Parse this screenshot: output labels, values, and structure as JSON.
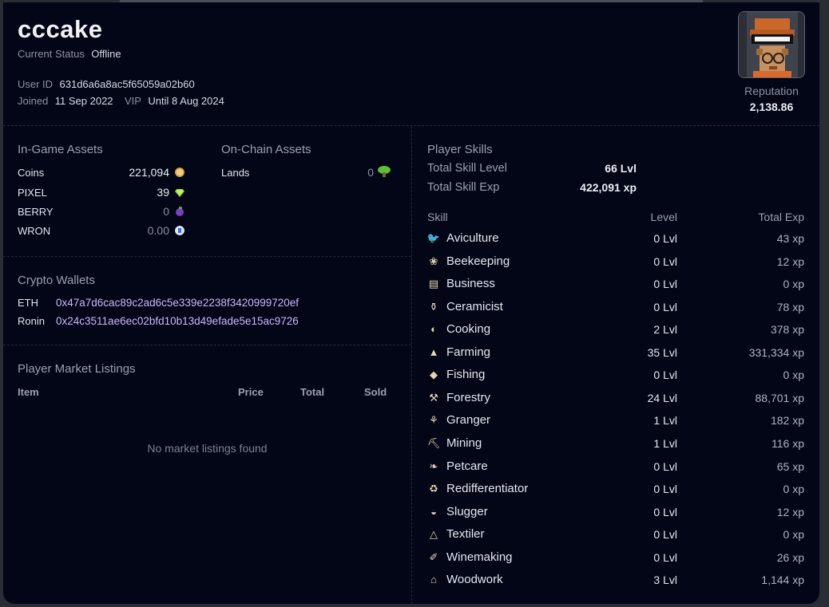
{
  "profile": {
    "username": "cccake",
    "status_label": "Current Status",
    "status_value": "Offline",
    "user_id_label": "User ID",
    "user_id_value": "631d6a6a8ac5f65059a02b60",
    "joined_label": "Joined",
    "joined_value": "11 Sep 2022",
    "vip_label": "VIP",
    "vip_value": "Until 8 Aug 2024",
    "reputation_label": "Reputation",
    "reputation_value": "2,138.86"
  },
  "in_game_assets": {
    "title": "In-Game Assets",
    "items": [
      {
        "label": "Coins",
        "value": "221,094",
        "icon": "coin-icon",
        "color": "#e8c36a"
      },
      {
        "label": "PIXEL",
        "value": "39",
        "icon": "gem-icon",
        "color": "#8fd13b"
      },
      {
        "label": "BERRY",
        "value": "0",
        "icon": "berry-icon",
        "color": "#8e4fd0"
      },
      {
        "label": "WRON",
        "value": "0.00",
        "icon": "ronin-icon",
        "color": "#7aa6e8"
      }
    ]
  },
  "on_chain_assets": {
    "title": "On-Chain Assets",
    "items": [
      {
        "label": "Lands",
        "value": "0",
        "icon": "tree-icon",
        "color": "#5fbf3a"
      }
    ]
  },
  "wallets": {
    "title": "Crypto Wallets",
    "items": [
      {
        "label": "ETH",
        "address": "0x47a7d6cac89c2ad6c5e339e2238f3420999720ef"
      },
      {
        "label": "Ronin",
        "address": "0x24c3511ae6ec02bfd10b13d49efade5e15ac9726"
      }
    ]
  },
  "market": {
    "title": "Player Market Listings",
    "columns": [
      "Item",
      "Price",
      "Total",
      "Sold"
    ],
    "empty_text": "No market listings found"
  },
  "skills": {
    "title": "Player Skills",
    "total_level_label": "Total Skill Level",
    "total_level_value": "66 Lvl",
    "total_exp_label": "Total Skill Exp",
    "total_exp_value": "422,091 xp",
    "columns": [
      "Skill",
      "Level",
      "Total Exp"
    ],
    "rows": [
      {
        "name": "Aviculture",
        "level": "0 Lvl",
        "exp": "43 xp",
        "icon": "bird-icon"
      },
      {
        "name": "Beekeeping",
        "level": "0 Lvl",
        "exp": "12 xp",
        "icon": "bee-icon"
      },
      {
        "name": "Business",
        "level": "0 Lvl",
        "exp": "0 xp",
        "icon": "briefcase-icon"
      },
      {
        "name": "Ceramicist",
        "level": "0 Lvl",
        "exp": "78 xp",
        "icon": "vase-icon"
      },
      {
        "name": "Cooking",
        "level": "2 Lvl",
        "exp": "378 xp",
        "icon": "pan-icon"
      },
      {
        "name": "Farming",
        "level": "35 Lvl",
        "exp": "331,334 xp",
        "icon": "hat-icon"
      },
      {
        "name": "Fishing",
        "level": "0 Lvl",
        "exp": "0 xp",
        "icon": "fish-icon"
      },
      {
        "name": "Forestry",
        "level": "24 Lvl",
        "exp": "88,701 xp",
        "icon": "axe-icon"
      },
      {
        "name": "Granger",
        "level": "1 Lvl",
        "exp": "182 xp",
        "icon": "wheat-icon"
      },
      {
        "name": "Mining",
        "level": "1 Lvl",
        "exp": "116 xp",
        "icon": "pickaxe-icon"
      },
      {
        "name": "Petcare",
        "level": "0 Lvl",
        "exp": "65 xp",
        "icon": "paw-icon"
      },
      {
        "name": "Redifferentiator",
        "level": "0 Lvl",
        "exp": "0 xp",
        "icon": "recycle-icon"
      },
      {
        "name": "Slugger",
        "level": "0 Lvl",
        "exp": "12 xp",
        "icon": "slug-icon"
      },
      {
        "name": "Textiler",
        "level": "0 Lvl",
        "exp": "0 xp",
        "icon": "yarn-icon"
      },
      {
        "name": "Winemaking",
        "level": "0 Lvl",
        "exp": "26 xp",
        "icon": "bottle-icon"
      },
      {
        "name": "Woodwork",
        "level": "3 Lvl",
        "exp": "1,144 xp",
        "icon": "chair-icon"
      }
    ]
  }
}
